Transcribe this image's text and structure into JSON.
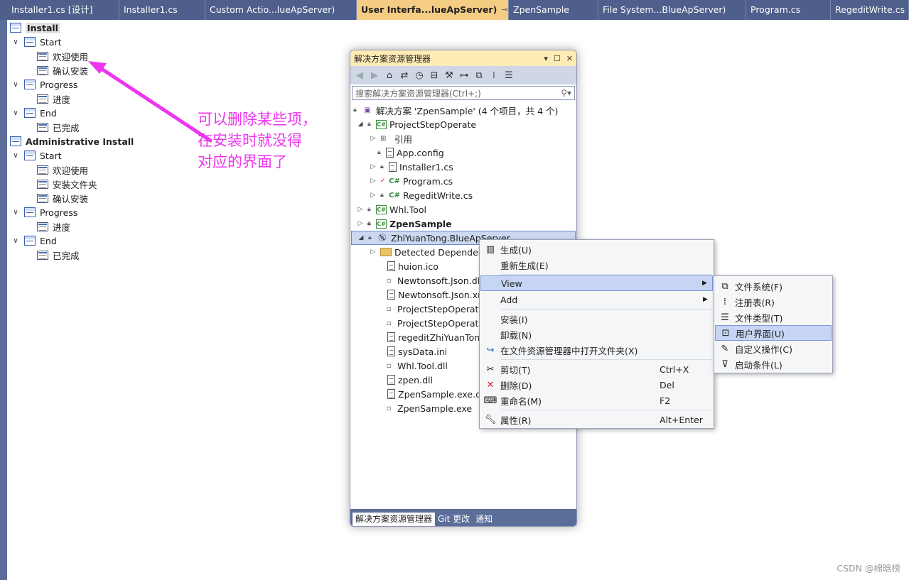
{
  "tabs": [
    {
      "label": "Installer1.cs [设计]"
    },
    {
      "label": "Installer1.cs"
    },
    {
      "label": "Custom Actio...lueApServer)"
    },
    {
      "label": "User Interfa...lueApServer)"
    },
    {
      "label": "ZpenSample"
    },
    {
      "label": "File System...BlueApServer)"
    },
    {
      "label": "Program.cs"
    },
    {
      "label": "RegeditWrite.cs"
    }
  ],
  "tab_active_pin": "⊸",
  "tab_active_close": "✕",
  "ui_tree": {
    "install": "Install",
    "install_start": "Start",
    "install_start_1": "欢迎使用",
    "install_start_2": "确认安装",
    "install_progress": "Progress",
    "install_progress_1": "进度",
    "install_end": "End",
    "install_end_1": "已完成",
    "admin": "Administrative Install",
    "admin_start": "Start",
    "admin_start_1": "欢迎使用",
    "admin_start_2": "安装文件夹",
    "admin_start_3": "确认安装",
    "admin_progress": "Progress",
    "admin_progress_1": "进度",
    "admin_end": "End",
    "admin_end_1": "已完成"
  },
  "annotation": {
    "line1": "可以删除某些项，",
    "line2": "在安装时就没得",
    "line3": "对应的界面了",
    "color": "#ef34ef"
  },
  "solution_explorer": {
    "title": "解决方案资源管理器",
    "search_placeholder": "搜索解决方案资源管理器(Ctrl+;)",
    "rows": {
      "solution": "解决方案 'ZpenSample' (4 个项目，共 4 个)",
      "proj1": "ProjectStepOperate",
      "ref": "引用",
      "appconfig": "App.config",
      "installer": "Installer1.cs",
      "program": "Program.cs",
      "regedit": "RegeditWrite.cs",
      "whl": "Whl.Tool",
      "zpen": "ZpenSample",
      "zhiyuan": "ZhiYuanTong.BlueApServer",
      "detected": "Detected Dependencies",
      "huion": "huion.ico",
      "newton1": "Newtonsoft.Json.dll",
      "newton2": "Newtonsoft.Json.xml",
      "pso1": "ProjectStepOperate",
      "pso2": "ProjectStepOperate",
      "regeditzy": "regeditZhiYuanTong",
      "sysdata": "sysData.ini",
      "whldll": "Whl.Tool.dll",
      "zpendll": "zpen.dll",
      "zpenconfig": "ZpenSample.exe.config",
      "zpenexe": "ZpenSample.exe"
    },
    "bottom_tabs": [
      "解决方案资源管理器",
      "Git 更改",
      "通知"
    ]
  },
  "context_menu": {
    "build": "生成(U)",
    "rebuild": "重新生成(E)",
    "view": "View",
    "add": "Add",
    "install": "安装(I)",
    "uninstall": "卸载(N)",
    "open_folder": "在文件资源管理器中打开文件夹(X)",
    "cut": "剪切(T)",
    "cut_key": "Ctrl+X",
    "delete": "删除(D)",
    "delete_key": "Del",
    "rename": "重命名(M)",
    "rename_key": "F2",
    "properties": "属性(R)",
    "properties_key": "Alt+Enter"
  },
  "view_submenu": {
    "filesystem": "文件系统(F)",
    "registry": "注册表(R)",
    "filetypes": "文件类型(T)",
    "ui": "用户界面(U)",
    "custom": "自定义操作(C)",
    "launch": "启动条件(L)"
  },
  "watermark": "CSDN @棉晗榜"
}
